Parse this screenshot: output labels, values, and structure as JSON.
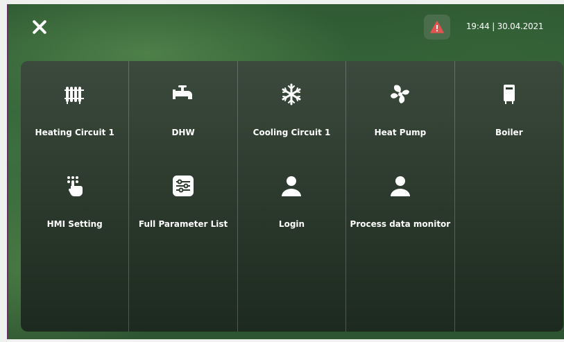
{
  "header": {
    "datetime": "19:44 | 30.04.2021",
    "icons": {
      "close": "close-icon",
      "alarm": "warning-icon"
    },
    "alarm_color": "#e0554f"
  },
  "menu": {
    "items": [
      {
        "label": "Heating Circuit 1",
        "icon": "radiator-icon"
      },
      {
        "label": "DHW",
        "icon": "faucet-icon"
      },
      {
        "label": "Cooling Circuit 1",
        "icon": "snowflake-icon"
      },
      {
        "label": "Heat Pump",
        "icon": "fan-icon"
      },
      {
        "label": "Boiler",
        "icon": "boiler-icon"
      },
      {
        "label": "HMI Setting",
        "icon": "touch-icon"
      },
      {
        "label": "Full Parameter List",
        "icon": "sliders-icon"
      },
      {
        "label": "Login",
        "icon": "user-icon"
      },
      {
        "label": "Process data monitor",
        "icon": "user-icon"
      }
    ]
  }
}
